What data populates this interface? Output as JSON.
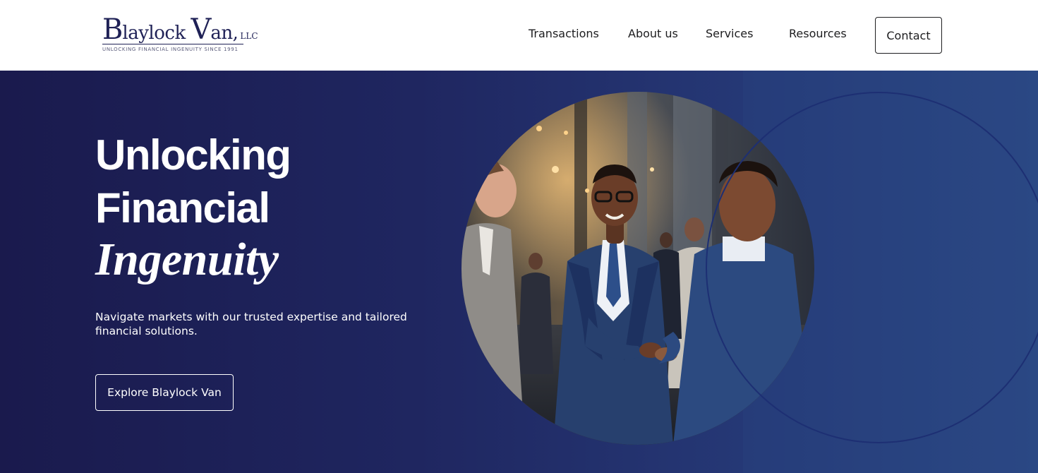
{
  "header": {
    "logo": {
      "wordmark": "Blaylock Van, LLC",
      "tagline": "UNLOCKING FINANCIAL INGENUITY SINCE 1991"
    },
    "nav": {
      "items": [
        {
          "label": "Transactions"
        },
        {
          "label": "About us"
        },
        {
          "label": "Services"
        },
        {
          "label": "Resources"
        }
      ],
      "contact_label": "Contact"
    }
  },
  "hero": {
    "headline_line1": "Unlocking",
    "headline_line2": "Financial",
    "headline_line3": "Ingenuity",
    "subtitle": "Navigate markets with our trusted expertise and tailored financial solutions.",
    "cta_label": "Explore Blaylock Van",
    "image_description_icon": "business-handshake-photo"
  },
  "colors": {
    "brand_navy": "#1f2156",
    "hero_start": "#1a1a4d",
    "hero_end": "#2c4a86",
    "text_dark": "#1d1d1f",
    "white": "#ffffff"
  }
}
